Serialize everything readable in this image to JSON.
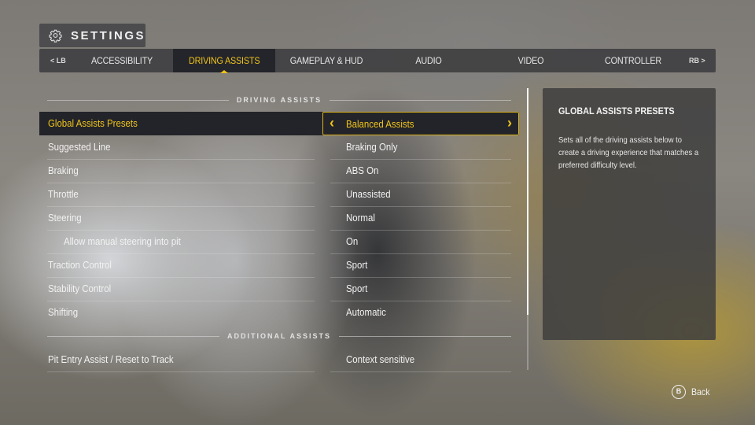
{
  "header": {
    "title": "SETTINGS",
    "icon": "gear-icon"
  },
  "tabs": {
    "left_bumper": "< LB",
    "right_bumper": "RB >",
    "items": [
      {
        "label": "ACCESSIBILITY",
        "active": false
      },
      {
        "label": "DRIVING ASSISTS",
        "active": true
      },
      {
        "label": "GAMEPLAY & HUD",
        "active": false
      },
      {
        "label": "AUDIO",
        "active": false
      },
      {
        "label": "VIDEO",
        "active": false
      },
      {
        "label": "CONTROLLER",
        "active": false
      }
    ]
  },
  "sections": {
    "driving_assists": "DRIVING ASSISTS",
    "additional_assists": "ADDITIONAL ASSISTS"
  },
  "settings": [
    {
      "label": "Global Assists Presets",
      "value": "Balanced Assists",
      "selected": true
    },
    {
      "label": "Suggested Line",
      "value": "Braking Only"
    },
    {
      "label": "Braking",
      "value": "ABS On"
    },
    {
      "label": "Throttle",
      "value": "Unassisted"
    },
    {
      "label": "Steering",
      "value": "Normal"
    },
    {
      "label": "Allow manual steering into pit",
      "value": "On",
      "indent": true
    },
    {
      "label": "Traction Control",
      "value": "Sport"
    },
    {
      "label": "Stability Control",
      "value": "Sport"
    },
    {
      "label": "Shifting",
      "value": "Automatic"
    },
    {
      "label": "Pit Entry Assist / Reset to Track",
      "value": "Context sensitive"
    }
  ],
  "selector_arrows": {
    "left": "‹",
    "right": "›"
  },
  "info": {
    "title": "GLOBAL ASSISTS PRESETS",
    "body": "Sets all of the driving assists below to create a driving experience that matches a preferred difficulty level."
  },
  "footer": {
    "back_button": "B",
    "back_label": "Back"
  },
  "colors": {
    "accent": "#f0c419",
    "selected_bg": "#23242a"
  }
}
